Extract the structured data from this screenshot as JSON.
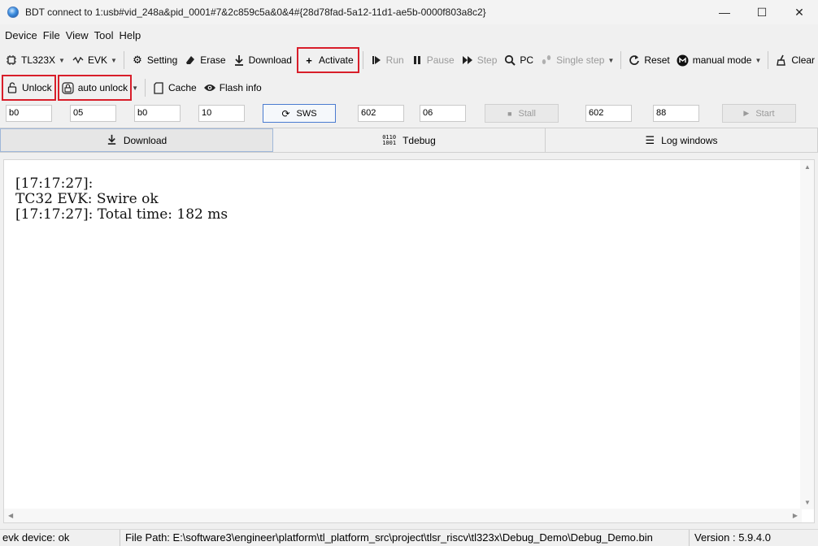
{
  "window": {
    "title": "BDT connect to 1:usb#vid_248a&pid_0001#7&2c859c5a&0&4#{28d78fad-5a12-11d1-ae5b-0000f803a8c2}",
    "minimize": "—",
    "maximize": "☐",
    "close": "✕"
  },
  "menu": [
    "Device",
    "File",
    "View",
    "Tool",
    "Help"
  ],
  "toolbar1": {
    "chip": "TL323X",
    "board": "EVK",
    "setting": "Setting",
    "erase": "Erase",
    "download": "Download",
    "activate": "Activate",
    "run": "Run",
    "pause": "Pause",
    "step": "Step",
    "pc": "PC",
    "single_step": "Single step",
    "reset": "Reset",
    "mode": "manual mode",
    "clear": "Clear"
  },
  "toolbar2": {
    "unlock": "Unlock",
    "auto_unlock": "auto unlock",
    "cache": "Cache",
    "flash_info": "Flash info"
  },
  "fields": {
    "f1": "b0",
    "f2": "05",
    "f3": "b0",
    "f4": "10",
    "sws": "SWS",
    "f5": "602",
    "f6": "06",
    "stall": "Stall",
    "f7": "602",
    "f8": "88",
    "start": "Start"
  },
  "tabs": [
    "Download",
    "Tdebug",
    "Log windows"
  ],
  "log": {
    "line1": "[17:17:27]:",
    "line2": "TC32 EVK: Swire ok",
    "line3": "[17:17:27]: Total time: 182 ms"
  },
  "status": {
    "device": "evk device: ok",
    "file_path": "File Path:  E:\\software3\\engineer\\platform\\tl_platform_src\\project\\tlsr_riscv\\tl323x\\Debug_Demo\\Debug_Demo.bin",
    "version": "Version : 5.9.4.0"
  },
  "colors": {
    "highlight": "#d81e2a",
    "accent": "#4a7bd0"
  }
}
